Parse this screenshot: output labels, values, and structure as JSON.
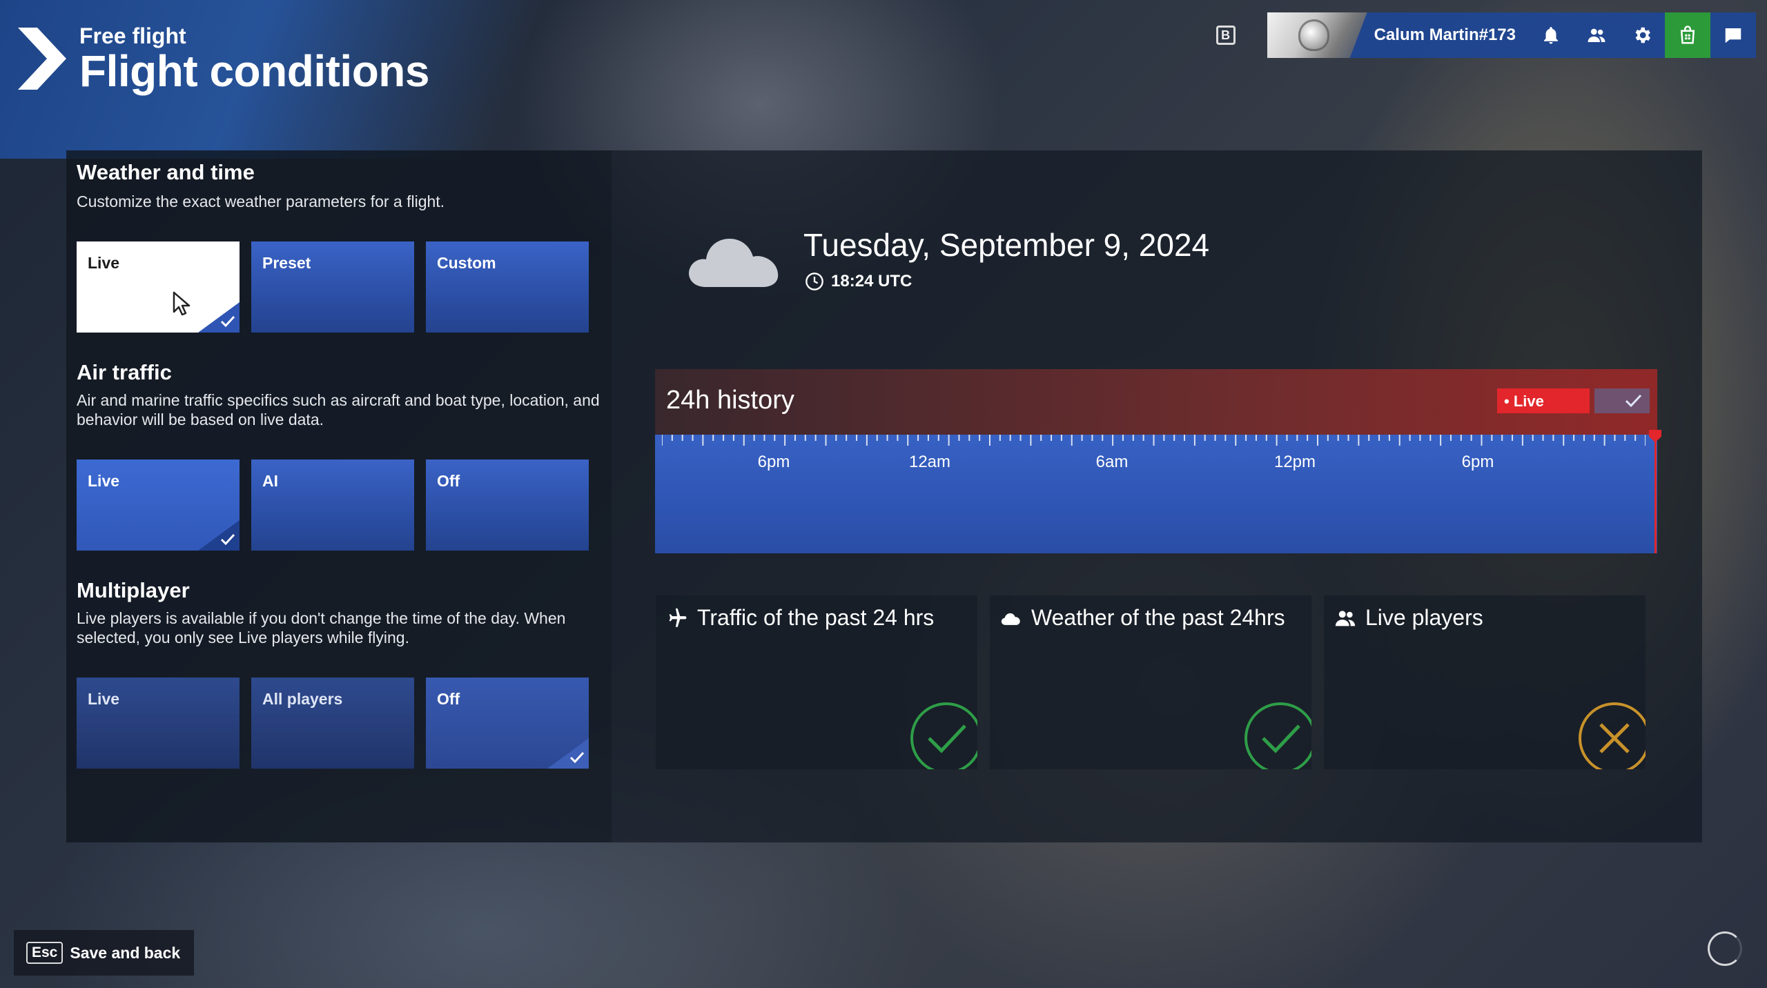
{
  "header": {
    "subtitle": "Free flight",
    "title": "Flight conditions"
  },
  "topbar": {
    "key_hint": "B",
    "username": "Calum Martin#173"
  },
  "weather_time": {
    "title": "Weather and time",
    "description": "Customize the exact weather parameters for a flight.",
    "options": [
      "Live",
      "Preset",
      "Custom"
    ],
    "selected": "Live"
  },
  "air_traffic": {
    "title": "Air traffic",
    "description": "Air and marine traffic specifics such as aircraft and boat type, location, and behavior will be based on live data.",
    "options": [
      "Live",
      "AI",
      "Off"
    ],
    "selected": "Live"
  },
  "multiplayer": {
    "title": "Multiplayer",
    "description": "Live players is available if you don't change the time of the day. When selected, you only see Live players while flying.",
    "options": [
      "Live",
      "All players",
      "Off"
    ],
    "selected": "Off"
  },
  "conditions": {
    "date": "Tuesday, September 9, 2024",
    "time": "18:24 UTC"
  },
  "history": {
    "title": "24h history",
    "live_label": "• Live",
    "tick_labels": [
      "6pm",
      "12am",
      "6am",
      "12pm",
      "6pm"
    ]
  },
  "status_cards": [
    {
      "label": "Traffic of the past 24 hrs",
      "icon": "plane-icon",
      "status": "ok"
    },
    {
      "label": "Weather of the past 24hrs",
      "icon": "cloud-icon",
      "status": "ok"
    },
    {
      "label": "Live players",
      "icon": "players-icon",
      "status": "off"
    }
  ],
  "footer": {
    "esc_key": "Esc",
    "save_label": "Save and back"
  },
  "colors": {
    "accent_blue": "#3761c4",
    "live_red": "#e2262b",
    "ok_green": "#2e9e48",
    "off_amber": "#c8922a",
    "store_green": "#2d9a3a"
  }
}
